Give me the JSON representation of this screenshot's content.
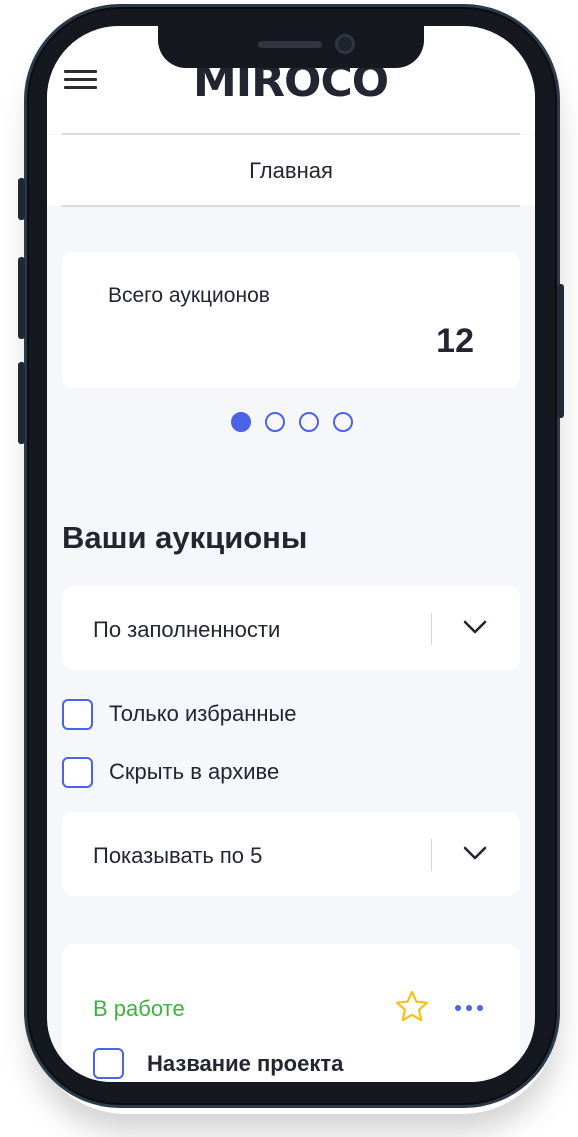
{
  "header": {
    "logo": "MIROCO",
    "menu_icon": "hamburger-menu-icon",
    "page_title": "Главная"
  },
  "stats": {
    "label": "Всего аукционов",
    "value": "12",
    "carousel_pages": 4,
    "active_page": 1
  },
  "auctions": {
    "section_title": "Ваши аукционы",
    "sort_select": {
      "value": "По заполненности",
      "icon": "chevron-down-icon"
    },
    "filters": [
      {
        "label": "Только избранные",
        "checked": false
      },
      {
        "label": "Скрыть в архиве",
        "checked": false
      }
    ],
    "page_size_select": {
      "value": "Показывать по 5",
      "icon": "chevron-down-icon"
    },
    "items": [
      {
        "status": "В работе",
        "status_color": "#3db33a",
        "favorite_icon": "star-outline-icon",
        "more_icon": "more-dots-icon",
        "name": "Название проекта",
        "checked": false
      }
    ]
  },
  "colors": {
    "accent": "#4a63e8",
    "favorite": "#f2c21b",
    "text": "#222630",
    "background": "#f5f7fa"
  }
}
